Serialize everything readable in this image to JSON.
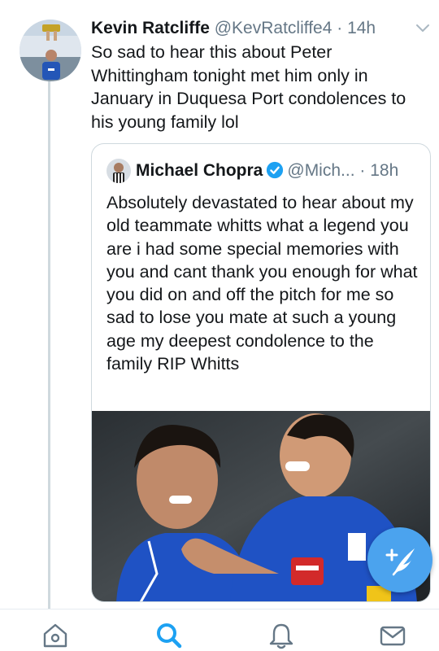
{
  "tweet": {
    "author_name": "Kevin Ratcliffe",
    "author_handle": "@KevRatcliffe4",
    "separator": " · ",
    "time": "14h",
    "text": "So sad to hear this about Peter Whittingham tonight met him only in January in Duquesa Port condolences to his young family lol"
  },
  "quoted_tweet": {
    "author_name": "Michael Chopra",
    "author_handle": "@Mich...",
    "separator": " · ",
    "time": "18h",
    "verified": true,
    "text": "Absolutely devastated to hear about my old teammate whitts what a legend you are i had some special memories with you and cant thank you enough for what you did on and off the pitch for me so sad to lose you mate at such a young age my deepest condolence to the family RIP Whitts"
  },
  "nav": {
    "tabs": [
      {
        "name": "home",
        "icon": "home-icon"
      },
      {
        "name": "search",
        "icon": "search-icon",
        "active": true
      },
      {
        "name": "notifications",
        "icon": "bell-icon"
      },
      {
        "name": "messages",
        "icon": "mail-icon"
      }
    ]
  },
  "colors": {
    "accent": "#1da1f2",
    "fab": "#4ba3ee",
    "secondary_text": "#657786",
    "border": "#cfd9de"
  },
  "icons": {
    "more": "chevron-down-icon",
    "compose": "compose-feather-icon",
    "verified": "verified-badge-icon"
  }
}
